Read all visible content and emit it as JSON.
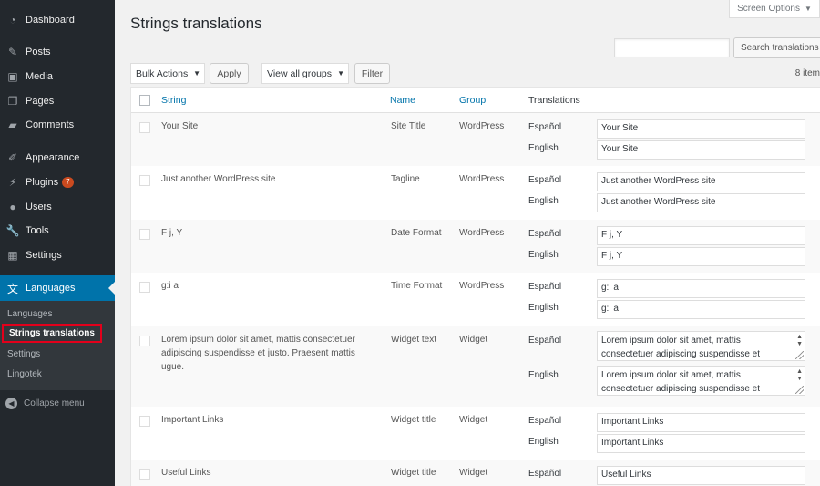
{
  "sidebar": {
    "items": [
      {
        "label": "Dashboard",
        "icon": "dashboard-icon"
      },
      {
        "label": "Posts",
        "icon": "pin-icon"
      },
      {
        "label": "Media",
        "icon": "media-icon"
      },
      {
        "label": "Pages",
        "icon": "pages-icon"
      },
      {
        "label": "Comments",
        "icon": "comment-icon"
      },
      {
        "label": "Appearance",
        "icon": "brush-icon"
      },
      {
        "label": "Plugins",
        "icon": "plug-icon",
        "badge": "7"
      },
      {
        "label": "Users",
        "icon": "user-icon"
      },
      {
        "label": "Tools",
        "icon": "wrench-icon"
      },
      {
        "label": "Settings",
        "icon": "settings-icon"
      },
      {
        "label": "Languages",
        "icon": "translate-icon"
      }
    ],
    "submenu": [
      "Languages",
      "Strings translations",
      "Settings",
      "Lingotek"
    ],
    "collapse_label": "Collapse menu",
    "colors": {
      "bg": "#23282d",
      "active": "#0073aa",
      "badge": "#ca4a1f",
      "highlight": "#e3001b"
    }
  },
  "header": {
    "title": "Strings translations",
    "screen_options": "Screen Options"
  },
  "toolbar": {
    "search_button": "Search translations",
    "bulk_actions": "Bulk Actions",
    "apply": "Apply",
    "group_filter": "View all groups",
    "filter": "Filter",
    "items_count": "8 item"
  },
  "table": {
    "columns": {
      "string": "String",
      "name": "Name",
      "group": "Group",
      "translations": "Translations"
    },
    "rows": [
      {
        "string": "Your Site",
        "name": "Site Title",
        "group": "WordPress",
        "translations": [
          {
            "lang": "Español",
            "value": "Your Site"
          },
          {
            "lang": "English",
            "value": "Your Site"
          }
        ]
      },
      {
        "string": "Just another WordPress site",
        "name": "Tagline",
        "group": "WordPress",
        "translations": [
          {
            "lang": "Español",
            "value": "Just another WordPress site"
          },
          {
            "lang": "English",
            "value": "Just another WordPress site"
          }
        ]
      },
      {
        "string": "F j, Y",
        "name": "Date Format",
        "group": "WordPress",
        "translations": [
          {
            "lang": "Español",
            "value": "F j, Y"
          },
          {
            "lang": "English",
            "value": "F j, Y"
          }
        ]
      },
      {
        "string": "g:i a",
        "name": "Time Format",
        "group": "WordPress",
        "translations": [
          {
            "lang": "Español",
            "value": "g:i a"
          },
          {
            "lang": "English",
            "value": "g:i a"
          }
        ]
      },
      {
        "string": "Lorem ipsum dolor sit amet, mattis consectetuer adipiscing suspendisse et justo. Praesent mattis ugue.",
        "name": "Widget text",
        "group": "Widget",
        "translations": [
          {
            "lang": "Español",
            "value": "Lorem ipsum dolor sit amet, mattis consectetuer adipiscing suspendisse et"
          },
          {
            "lang": "English",
            "value": "Lorem ipsum dolor sit amet, mattis consectetuer adipiscing suspendisse et"
          }
        ]
      },
      {
        "string": "Important Links",
        "name": "Widget title",
        "group": "Widget",
        "translations": [
          {
            "lang": "Español",
            "value": "Important Links"
          },
          {
            "lang": "English",
            "value": "Important Links"
          }
        ]
      },
      {
        "string": "Useful Links",
        "name": "Widget title",
        "group": "Widget",
        "translations": [
          {
            "lang": "Español",
            "value": "Useful Links"
          }
        ]
      }
    ]
  }
}
